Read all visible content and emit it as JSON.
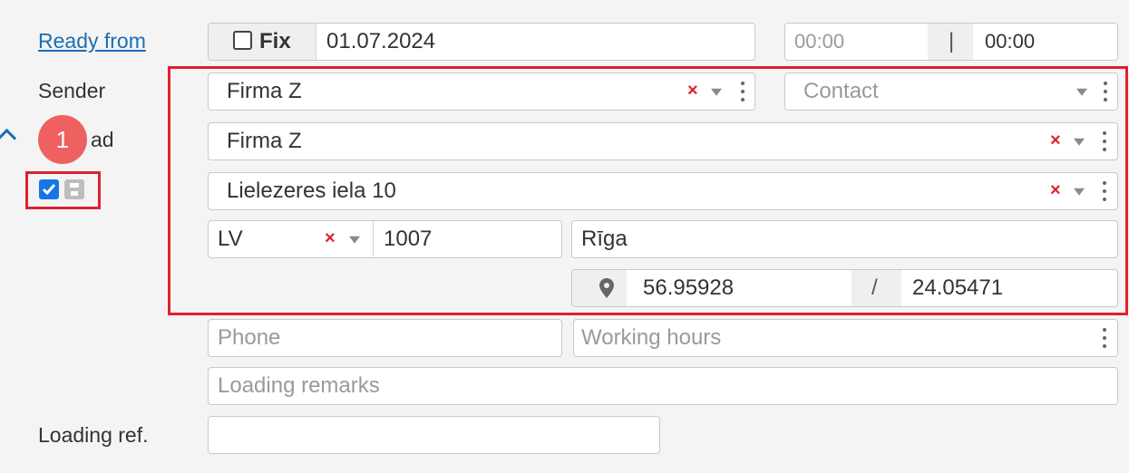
{
  "ready_from": {
    "label": "Ready from",
    "fix_label": "Fix",
    "fix_checked": false,
    "date": "01.07.2024",
    "time_from_placeholder": "00:00",
    "separator": "|",
    "time_to": "00:00"
  },
  "sender": {
    "label": "Sender",
    "company": "Firma Z",
    "contact_placeholder": "Contact"
  },
  "load": {
    "label_partial": "ad",
    "badge": "1",
    "company": "Firma Z",
    "address": "Lielezeres iela 10",
    "country": "LV",
    "postcode": "1007",
    "city": "Rīga",
    "lat": "56.95928",
    "coord_separator": "/",
    "lng": "24.05471",
    "save_checked": true
  },
  "contact": {
    "phone_placeholder": "Phone",
    "working_hours_placeholder": "Working hours",
    "remarks_placeholder": "Loading remarks"
  },
  "loading_ref": {
    "label": "Loading ref.",
    "value": ""
  },
  "colors": {
    "highlight": "#e0202c",
    "link": "#1a6fb5",
    "badge": "#ef5a5a"
  }
}
